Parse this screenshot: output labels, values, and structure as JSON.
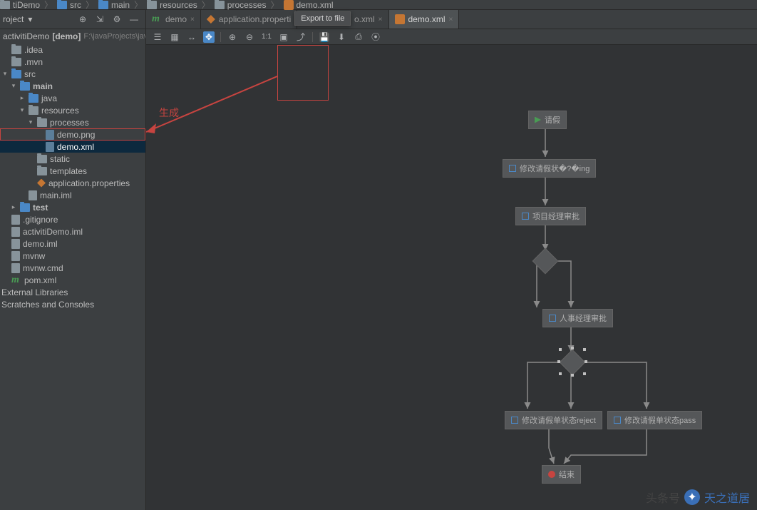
{
  "breadcrumb": [
    {
      "label": "tiDemo",
      "icon": "folder"
    },
    {
      "label": "src",
      "icon": "folder-blue"
    },
    {
      "label": "main",
      "icon": "folder-blue"
    },
    {
      "label": "resources",
      "icon": "folder"
    },
    {
      "label": "processes",
      "icon": "folder"
    },
    {
      "label": "demo.xml",
      "icon": "xml"
    }
  ],
  "project_label": "roject",
  "project_pulldown": "▾",
  "project_toolbar_icons": [
    "target",
    "collapse",
    "gear",
    "minimize"
  ],
  "tabs": [
    {
      "label": "demo",
      "icon": "m",
      "closable": true,
      "active": false
    },
    {
      "label": "application.properti",
      "icon": "prop",
      "closable": true,
      "active": false
    },
    {
      "label": "o.xml",
      "icon": "",
      "closable": true,
      "active": false,
      "hidden_by_tooltip": true
    },
    {
      "label": "demo.xml",
      "icon": "xml",
      "closable": true,
      "active": true
    }
  ],
  "tooltip": "Export to file",
  "tree_header": {
    "name": "activitiDemo",
    "bracket": "[demo]",
    "path": "F:\\javaProjects\\javawe"
  },
  "tree": [
    {
      "indent": 0,
      "arrow": "",
      "icon": "folder",
      "label": ".idea"
    },
    {
      "indent": 0,
      "arrow": "",
      "icon": "folder",
      "label": ".mvn"
    },
    {
      "indent": 0,
      "arrow": "down",
      "icon": "folder-blue",
      "label": "src"
    },
    {
      "indent": 1,
      "arrow": "down",
      "icon": "folder-blue",
      "label": "main",
      "bold": true
    },
    {
      "indent": 2,
      "arrow": "right",
      "icon": "folder-blue",
      "label": "java"
    },
    {
      "indent": 2,
      "arrow": "down",
      "icon": "folder",
      "label": "resources"
    },
    {
      "indent": 3,
      "arrow": "down",
      "icon": "folder",
      "label": "processes"
    },
    {
      "indent": 4,
      "arrow": "",
      "icon": "img",
      "label": "demo.png",
      "highlight": true
    },
    {
      "indent": 4,
      "arrow": "",
      "icon": "xml",
      "label": "demo.xml",
      "selected": true
    },
    {
      "indent": 3,
      "arrow": "",
      "icon": "folder",
      "label": "static"
    },
    {
      "indent": 3,
      "arrow": "",
      "icon": "folder",
      "label": "templates"
    },
    {
      "indent": 3,
      "arrow": "",
      "icon": "prop",
      "label": "application.properties"
    },
    {
      "indent": 2,
      "arrow": "",
      "icon": "file",
      "label": "main.iml"
    },
    {
      "indent": 1,
      "arrow": "right",
      "icon": "folder-blue",
      "label": "test",
      "bold": true
    },
    {
      "indent": 0,
      "arrow": "",
      "icon": "file",
      "label": ".gitignore"
    },
    {
      "indent": 0,
      "arrow": "",
      "icon": "file",
      "label": "activitiDemo.iml"
    },
    {
      "indent": 0,
      "arrow": "",
      "icon": "file",
      "label": "demo.iml"
    },
    {
      "indent": 0,
      "arrow": "",
      "icon": "file",
      "label": "mvnw"
    },
    {
      "indent": 0,
      "arrow": "",
      "icon": "file",
      "label": "mvnw.cmd"
    },
    {
      "indent": 0,
      "arrow": "",
      "icon": "m",
      "label": "pom.xml"
    },
    {
      "indent": -1,
      "arrow": "",
      "icon": "",
      "label": "External Libraries"
    },
    {
      "indent": -1,
      "arrow": "",
      "icon": "",
      "label": "Scratches and Consoles"
    }
  ],
  "editor_toolbar": [
    "layout",
    "grid",
    "align",
    "boxed",
    "sep",
    "zoom-in",
    "zoom-out",
    "1:1",
    "fit",
    "share",
    "sep",
    "save",
    "export",
    "print",
    "video"
  ],
  "toolbar_label_11": "1:1",
  "annotation_text": "生成",
  "flow": {
    "start": {
      "label": "请假"
    },
    "t1": {
      "label": "修改请假状�?�ing"
    },
    "t2": {
      "label": "项目经理审批"
    },
    "t3": {
      "label": "人事经理审批"
    },
    "t4": {
      "label": "修改请假单状态reject"
    },
    "t5": {
      "label": "修改请假单状态pass"
    },
    "end": {
      "label": "结束"
    }
  },
  "watermark": {
    "prefix": "头条号",
    "name": "天之道居"
  }
}
